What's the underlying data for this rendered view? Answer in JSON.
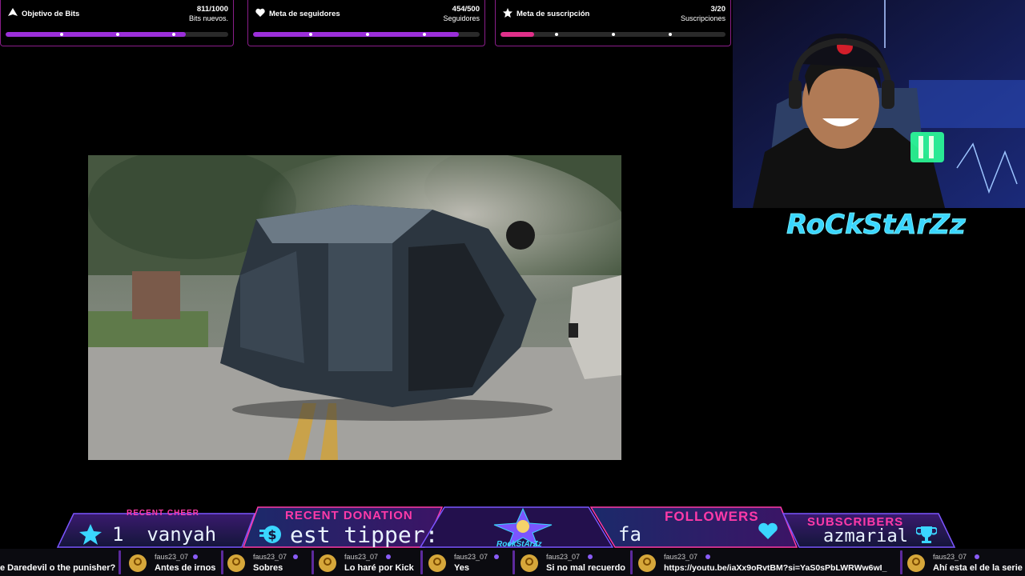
{
  "goals": {
    "bits": {
      "title": "Objetivo de Bits",
      "count": "811/1000",
      "sub": "Bits nuevos.",
      "progress": 0.811,
      "color": "#9b2fd9"
    },
    "followers": {
      "title": "Meta de seguidores",
      "count": "454/500",
      "sub": "Seguidores",
      "progress": 0.908,
      "color": "#9b2fd9"
    },
    "subs": {
      "title": "Meta de suscripción",
      "count": "3/20",
      "sub": "Suscripciones",
      "progress": 0.15,
      "color": "#e0308a"
    }
  },
  "streamer": {
    "logo_text": "RoCkStArZz"
  },
  "bottom": {
    "recent_cheer": {
      "label": "RECENT CHEER",
      "value": "1  vanyah"
    },
    "recent_donation": {
      "label": "RECENT DONATION",
      "value": "est tipper:"
    },
    "center_logo": "RockStArZz",
    "followers": {
      "label": "FOLLOWERS",
      "value": "fa"
    },
    "subscribers": {
      "label": "SUBSCRIBERS",
      "value": "azmarial"
    }
  },
  "chat": [
    {
      "user": "",
      "msg": "e Daredevil o the punisher?"
    },
    {
      "user": "faus23_07",
      "msg": "Antes de irnos"
    },
    {
      "user": "faus23_07",
      "msg": "Sobres"
    },
    {
      "user": "faus23_07",
      "msg": "Lo haré por Kick"
    },
    {
      "user": "faus23_07",
      "msg": "Yes"
    },
    {
      "user": "faus23_07",
      "msg": "Si no mal recuerdo"
    },
    {
      "user": "faus23_07",
      "msg": "https://youtu.be/iaXx9oRvtBM?si=YaS0sPbLWRWw6wI_"
    },
    {
      "user": "faus23_07",
      "msg": "Ahí esta el de la serie"
    }
  ],
  "colors": {
    "accent": "#9b2fd9",
    "neon_pink": "#ff3aa8",
    "neon_cyan": "#3ad6ff"
  }
}
